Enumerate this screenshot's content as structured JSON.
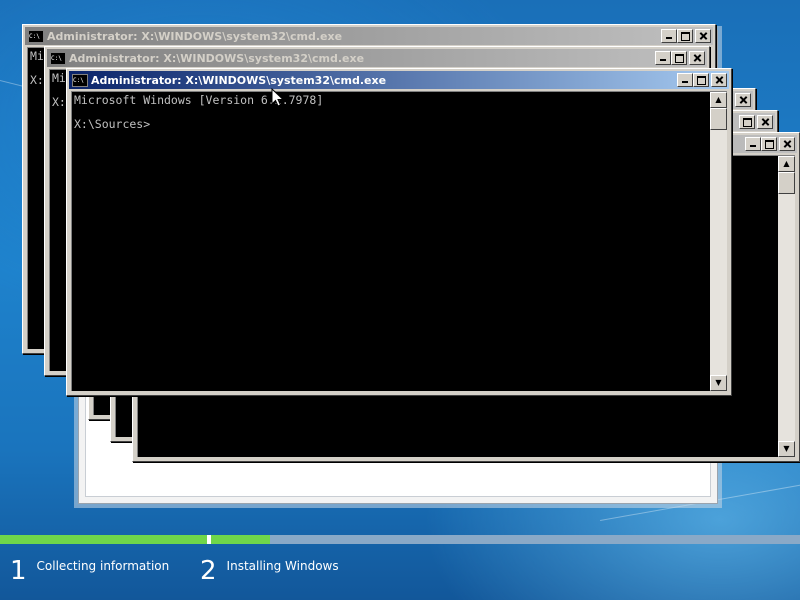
{
  "background": {
    "accent": "#1e82cc"
  },
  "windows": [
    {
      "title": "Administrator: X:\\WINDOWS\\system32\\cmd.exe",
      "text": "Mi\n\nX:",
      "state": "inactive"
    },
    {
      "title": "Administrator: X:\\WINDOWS\\system32\\cmd.exe",
      "text": "Mi\n\nX:",
      "state": "inactive"
    },
    {
      "title": "",
      "text": "",
      "state": "inactive"
    },
    {
      "title": "",
      "text": "",
      "state": "inactive"
    },
    {
      "title": "",
      "text": "",
      "state": "inactive"
    },
    {
      "title": "Administrator: X:\\WINDOWS\\system32\\cmd.exe",
      "text": "Microsoft Windows [Version 6.2.7978]\n\nX:\\Sources>",
      "state": "active"
    }
  ],
  "system_icon_text": "C:\\",
  "progress": {
    "step1_complete": 1.0,
    "step2_fraction": 0.35
  },
  "steps": [
    {
      "number": "1",
      "label": "Collecting information"
    },
    {
      "number": "2",
      "label": "Installing Windows"
    }
  ]
}
